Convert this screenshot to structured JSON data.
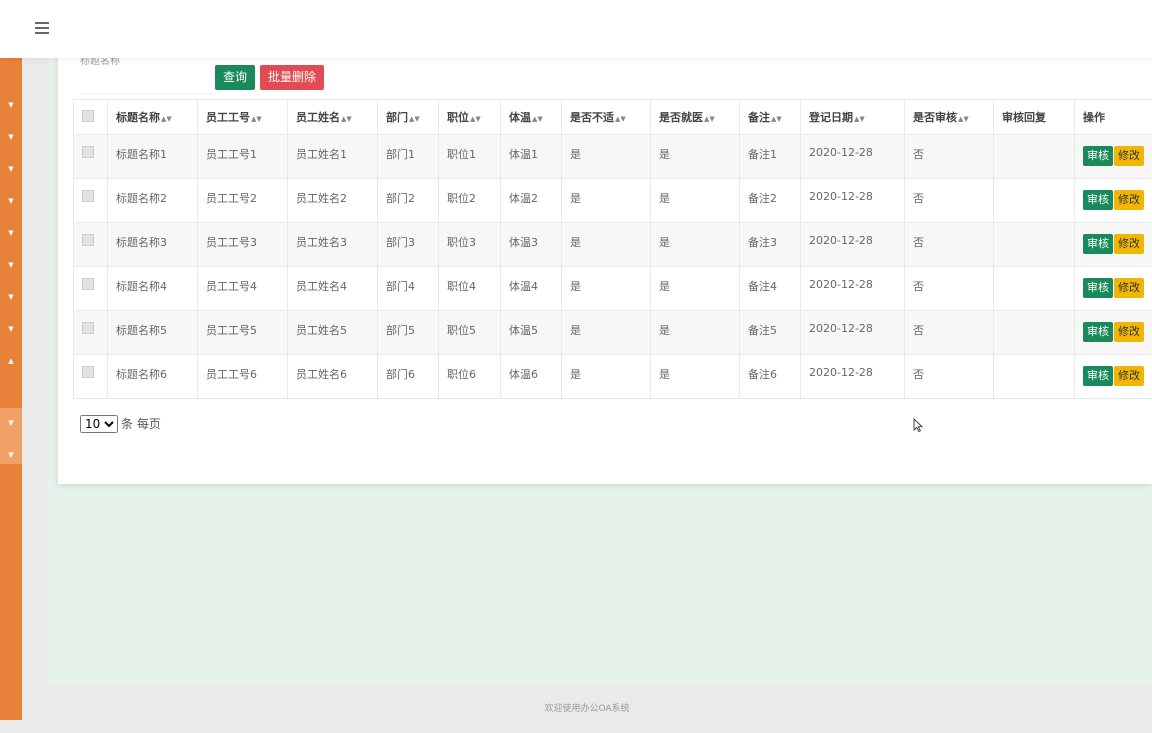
{
  "search": {
    "label": "标题名称",
    "placeholder": "",
    "value": "",
    "query_label": "查询",
    "batch_delete_label": "批量删除"
  },
  "table": {
    "columns": [
      "标题名称",
      "员工工号",
      "员工姓名",
      "部门",
      "职位",
      "体温",
      "是否不适",
      "是否就医",
      "备注",
      "登记日期",
      "是否审核",
      "审核回复",
      "操作"
    ],
    "rows": [
      [
        "标题名称1",
        "员工工号1",
        "员工姓名1",
        "部门1",
        "职位1",
        "体温1",
        "是",
        "是",
        "备注1",
        "2020-12-28",
        "否",
        ""
      ],
      [
        "标题名称2",
        "员工工号2",
        "员工姓名2",
        "部门2",
        "职位2",
        "体温2",
        "是",
        "是",
        "备注2",
        "2020-12-28",
        "否",
        ""
      ],
      [
        "标题名称3",
        "员工工号3",
        "员工姓名3",
        "部门3",
        "职位3",
        "体温3",
        "是",
        "是",
        "备注3",
        "2020-12-28",
        "否",
        ""
      ],
      [
        "标题名称4",
        "员工工号4",
        "员工姓名4",
        "部门4",
        "职位4",
        "体温4",
        "是",
        "是",
        "备注4",
        "2020-12-28",
        "否",
        ""
      ],
      [
        "标题名称5",
        "员工工号5",
        "员工姓名5",
        "部门5",
        "职位5",
        "体温5",
        "是",
        "是",
        "备注5",
        "2020-12-28",
        "否",
        ""
      ],
      [
        "标题名称6",
        "员工工号6",
        "员工姓名6",
        "部门6",
        "职位6",
        "体温6",
        "是",
        "是",
        "备注6",
        "2020-12-28",
        "否",
        ""
      ]
    ],
    "action_audit_label": "审核",
    "action_edit_label": "修改"
  },
  "pagination": {
    "page_size": "10",
    "page_size_options": [
      "10"
    ],
    "suffix": "条 每页"
  },
  "footer": {
    "text": "欢迎使用办公OA系统"
  },
  "icons": {
    "menu": "hamburger-menu-icon",
    "sort": "sort-icon",
    "sidebar_caret": "caret-down-icon"
  },
  "colors": {
    "sidebar": "#e8823a",
    "primary_green": "#1a8a5a",
    "danger_red": "#e34b54",
    "warning_yellow": "#f2b705",
    "content_bg": "#e5f2ea"
  }
}
